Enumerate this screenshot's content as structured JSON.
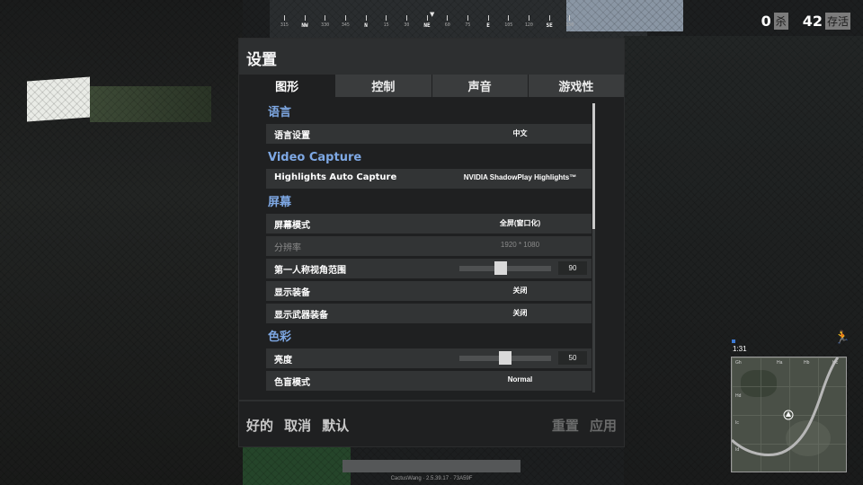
{
  "compass": {
    "ticks": [
      "315",
      "NW",
      "330",
      "345",
      "N",
      "15",
      "30",
      "NE",
      "60",
      "75",
      "E",
      "105",
      "120",
      "SE",
      "150"
    ]
  },
  "counters": {
    "kills_value": "0",
    "kills_label": "杀",
    "alive_value": "42",
    "alive_label": "存活"
  },
  "panel": {
    "title": "设置",
    "tabs": [
      {
        "label": "图形",
        "active": true
      },
      {
        "label": "控制",
        "active": false
      },
      {
        "label": "声音",
        "active": false
      },
      {
        "label": "游戏性",
        "active": false
      }
    ],
    "sections": {
      "language": {
        "header": "语言",
        "rows": [
          {
            "label": "语言设置",
            "value": "中文"
          }
        ]
      },
      "video_capture": {
        "header": "Video Capture",
        "rows": [
          {
            "label": "Highlights Auto Capture",
            "value": "NVIDIA ShadowPlay Highlights™"
          }
        ]
      },
      "screen": {
        "header": "屏幕",
        "rows": [
          {
            "label": "屏幕模式",
            "value": "全屏(窗口化)"
          },
          {
            "label": "分辨率",
            "value": "1920 * 1080"
          },
          {
            "label": "第一人称视角范围",
            "value": "90",
            "slider_fraction": 0.44
          },
          {
            "label": "显示装备",
            "value": "关闭"
          },
          {
            "label": "显示武器装备",
            "value": "关闭"
          }
        ]
      },
      "color": {
        "header": "色彩",
        "rows": [
          {
            "label": "亮度",
            "value": "50",
            "slider_fraction": 0.5
          },
          {
            "label": "色盲模式",
            "value": "Normal"
          }
        ]
      }
    },
    "footer": {
      "ok": "好的",
      "cancel": "取消",
      "default": "默认",
      "reset": "重置",
      "apply": "应用"
    }
  },
  "version_text": "CactusWang · 2.5.39.17 · 73A59F",
  "minimap": {
    "time": "1:31",
    "grid_labels": [
      "Gh",
      "Ha",
      "Hb",
      "Hc",
      "Hd",
      "Ic",
      "Id"
    ]
  },
  "colors": {
    "section_header": "#7ea8e4",
    "panel_bg": "#1f2021",
    "row_bg": "#323435"
  }
}
